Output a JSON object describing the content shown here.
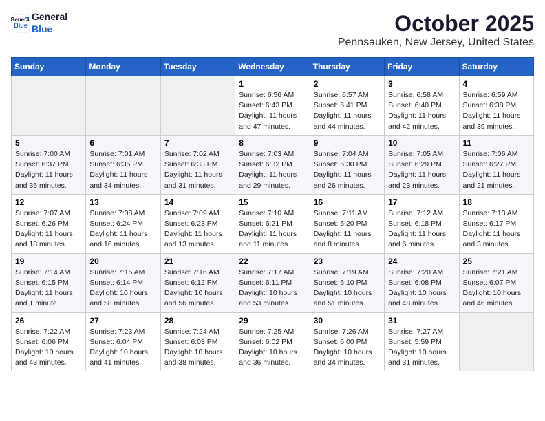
{
  "logo": {
    "general": "General",
    "blue": "Blue"
  },
  "header": {
    "title": "October 2025",
    "subtitle": "Pennsauken, New Jersey, United States"
  },
  "days_of_week": [
    "Sunday",
    "Monday",
    "Tuesday",
    "Wednesday",
    "Thursday",
    "Friday",
    "Saturday"
  ],
  "weeks": [
    [
      {
        "day": "",
        "info": ""
      },
      {
        "day": "",
        "info": ""
      },
      {
        "day": "",
        "info": ""
      },
      {
        "day": "1",
        "info": "Sunrise: 6:56 AM\nSunset: 6:43 PM\nDaylight: 11 hours and 47 minutes."
      },
      {
        "day": "2",
        "info": "Sunrise: 6:57 AM\nSunset: 6:41 PM\nDaylight: 11 hours and 44 minutes."
      },
      {
        "day": "3",
        "info": "Sunrise: 6:58 AM\nSunset: 6:40 PM\nDaylight: 11 hours and 42 minutes."
      },
      {
        "day": "4",
        "info": "Sunrise: 6:59 AM\nSunset: 6:38 PM\nDaylight: 11 hours and 39 minutes."
      }
    ],
    [
      {
        "day": "5",
        "info": "Sunrise: 7:00 AM\nSunset: 6:37 PM\nDaylight: 11 hours and 36 minutes."
      },
      {
        "day": "6",
        "info": "Sunrise: 7:01 AM\nSunset: 6:35 PM\nDaylight: 11 hours and 34 minutes."
      },
      {
        "day": "7",
        "info": "Sunrise: 7:02 AM\nSunset: 6:33 PM\nDaylight: 11 hours and 31 minutes."
      },
      {
        "day": "8",
        "info": "Sunrise: 7:03 AM\nSunset: 6:32 PM\nDaylight: 11 hours and 29 minutes."
      },
      {
        "day": "9",
        "info": "Sunrise: 7:04 AM\nSunset: 6:30 PM\nDaylight: 11 hours and 26 minutes."
      },
      {
        "day": "10",
        "info": "Sunrise: 7:05 AM\nSunset: 6:29 PM\nDaylight: 11 hours and 23 minutes."
      },
      {
        "day": "11",
        "info": "Sunrise: 7:06 AM\nSunset: 6:27 PM\nDaylight: 11 hours and 21 minutes."
      }
    ],
    [
      {
        "day": "12",
        "info": "Sunrise: 7:07 AM\nSunset: 6:26 PM\nDaylight: 11 hours and 18 minutes."
      },
      {
        "day": "13",
        "info": "Sunrise: 7:08 AM\nSunset: 6:24 PM\nDaylight: 11 hours and 16 minutes."
      },
      {
        "day": "14",
        "info": "Sunrise: 7:09 AM\nSunset: 6:23 PM\nDaylight: 11 hours and 13 minutes."
      },
      {
        "day": "15",
        "info": "Sunrise: 7:10 AM\nSunset: 6:21 PM\nDaylight: 11 hours and 11 minutes."
      },
      {
        "day": "16",
        "info": "Sunrise: 7:11 AM\nSunset: 6:20 PM\nDaylight: 11 hours and 8 minutes."
      },
      {
        "day": "17",
        "info": "Sunrise: 7:12 AM\nSunset: 6:18 PM\nDaylight: 11 hours and 6 minutes."
      },
      {
        "day": "18",
        "info": "Sunrise: 7:13 AM\nSunset: 6:17 PM\nDaylight: 11 hours and 3 minutes."
      }
    ],
    [
      {
        "day": "19",
        "info": "Sunrise: 7:14 AM\nSunset: 6:15 PM\nDaylight: 11 hours and 1 minute."
      },
      {
        "day": "20",
        "info": "Sunrise: 7:15 AM\nSunset: 6:14 PM\nDaylight: 10 hours and 58 minutes."
      },
      {
        "day": "21",
        "info": "Sunrise: 7:16 AM\nSunset: 6:12 PM\nDaylight: 10 hours and 56 minutes."
      },
      {
        "day": "22",
        "info": "Sunrise: 7:17 AM\nSunset: 6:11 PM\nDaylight: 10 hours and 53 minutes."
      },
      {
        "day": "23",
        "info": "Sunrise: 7:19 AM\nSunset: 6:10 PM\nDaylight: 10 hours and 51 minutes."
      },
      {
        "day": "24",
        "info": "Sunrise: 7:20 AM\nSunset: 6:08 PM\nDaylight: 10 hours and 48 minutes."
      },
      {
        "day": "25",
        "info": "Sunrise: 7:21 AM\nSunset: 6:07 PM\nDaylight: 10 hours and 46 minutes."
      }
    ],
    [
      {
        "day": "26",
        "info": "Sunrise: 7:22 AM\nSunset: 6:06 PM\nDaylight: 10 hours and 43 minutes."
      },
      {
        "day": "27",
        "info": "Sunrise: 7:23 AM\nSunset: 6:04 PM\nDaylight: 10 hours and 41 minutes."
      },
      {
        "day": "28",
        "info": "Sunrise: 7:24 AM\nSunset: 6:03 PM\nDaylight: 10 hours and 38 minutes."
      },
      {
        "day": "29",
        "info": "Sunrise: 7:25 AM\nSunset: 6:02 PM\nDaylight: 10 hours and 36 minutes."
      },
      {
        "day": "30",
        "info": "Sunrise: 7:26 AM\nSunset: 6:00 PM\nDaylight: 10 hours and 34 minutes."
      },
      {
        "day": "31",
        "info": "Sunrise: 7:27 AM\nSunset: 5:59 PM\nDaylight: 10 hours and 31 minutes."
      },
      {
        "day": "",
        "info": ""
      }
    ]
  ]
}
